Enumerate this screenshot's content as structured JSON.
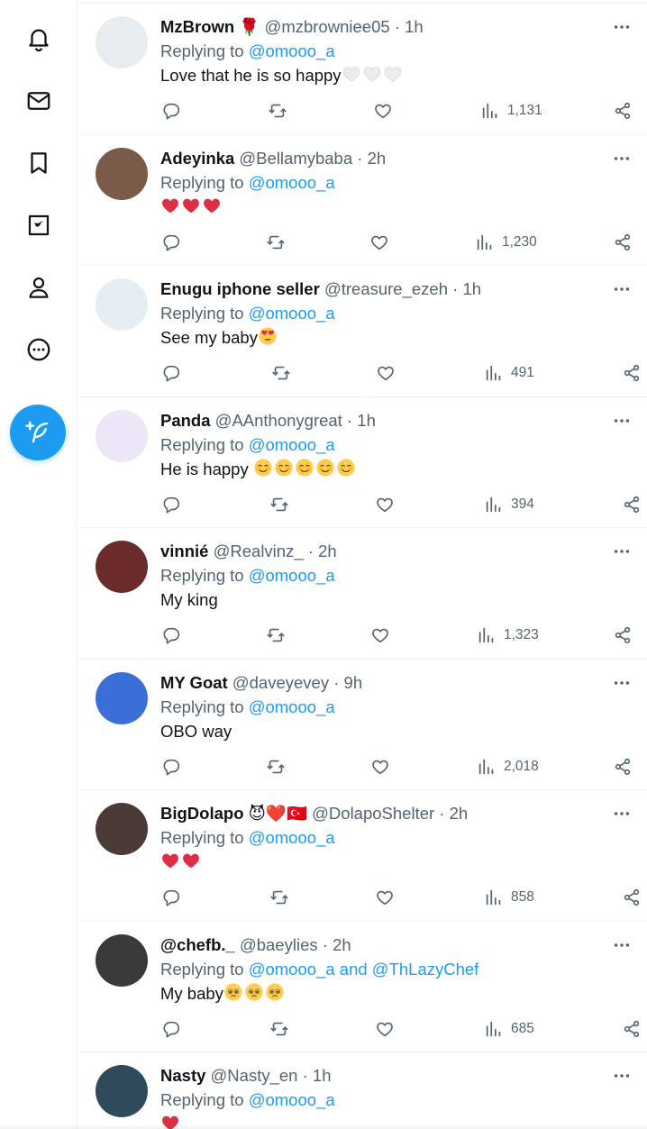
{
  "app": {
    "sidebar": {
      "items": [
        {
          "icon": "bell-icon",
          "label": "Notifications"
        },
        {
          "icon": "envelope-icon",
          "label": "Messages"
        },
        {
          "icon": "bookmark-icon",
          "label": "Bookmarks"
        },
        {
          "icon": "twitter-blue-icon",
          "label": "Twitter Blue"
        },
        {
          "icon": "person-icon",
          "label": "Profile"
        },
        {
          "icon": "more-circle-icon",
          "label": "More"
        }
      ],
      "compose_icon": "feather-plus-icon"
    },
    "colors": {
      "accent": "#1d9bf0",
      "secondary_text": "#536471",
      "heart": "#f91880"
    }
  },
  "replying_label": "Replying to",
  "tweets": [
    {
      "name": "MzBrown",
      "name_suffix": "🌹",
      "handle": "@mzbrowniee05",
      "time": "1h",
      "mention": "@omooo_a",
      "mention_extra": "",
      "text": "Love that he is so happy",
      "emojis": [
        "white-heart",
        "white-heart",
        "white-heart"
      ],
      "views": "1,131",
      "avatar_color": "#e9ecef"
    },
    {
      "name": "Adeyinka",
      "name_suffix": "",
      "handle": "@Bellamybaba",
      "time": "2h",
      "mention": "@omooo_a",
      "mention_extra": "",
      "text": "",
      "emojis": [
        "red-heart",
        "red-heart",
        "red-heart"
      ],
      "views": "1,230",
      "avatar_color": "#7a5a48"
    },
    {
      "name": "Enugu iphone seller",
      "name_suffix": "",
      "handle": "@treasure_ezeh",
      "time": "1h",
      "mention": "@omooo_a",
      "mention_extra": "",
      "text": "See my baby",
      "emojis": [
        "heart-eyes"
      ],
      "views": "491",
      "avatar_color": "#e7eef3"
    },
    {
      "name": "Panda",
      "name_suffix": "",
      "handle": "@AAnthonygreat",
      "time": "1h",
      "mention": "@omooo_a",
      "mention_extra": "",
      "text": "He is happy ",
      "emojis": [
        "smiling-blush",
        "smiling-blush",
        "smiling-blush",
        "smiling-blush",
        "smiling-blush"
      ],
      "views": "394",
      "avatar_color": "#ede6f6"
    },
    {
      "name": "vinnié",
      "name_suffix": "",
      "handle": "@Realvinz_",
      "time": "2h",
      "mention": "@omooo_a",
      "mention_extra": "",
      "text": "My king",
      "emojis": [],
      "views": "1,323",
      "avatar_color": "#6b2b2b"
    },
    {
      "name": "MY Goat",
      "name_suffix": "",
      "handle": "@daveyevey",
      "time": "9h",
      "mention": "@omooo_a",
      "mention_extra": "",
      "text": "OBO way",
      "emojis": [],
      "views": "2,018",
      "avatar_color": "#3b6fd8"
    },
    {
      "name": "BigDolapo",
      "name_suffix": "😈❤️🇹🇷",
      "handle": "@DolapoShelter",
      "time": "2h",
      "mention": "@omooo_a",
      "mention_extra": "",
      "text": "",
      "emojis": [
        "red-heart",
        "red-heart"
      ],
      "views": "858",
      "avatar_color": "#4a3b36"
    },
    {
      "name": "@chefb._",
      "name_suffix": "",
      "handle": "@baeylies",
      "time": "2h",
      "mention": "@omooo_a",
      "mention_extra": "and @ThLazyChef",
      "text": "My baby",
      "emojis": [
        "pleading-face",
        "pleading-face",
        "pleading-face"
      ],
      "views": "685",
      "avatar_color": "#3a3a3a"
    },
    {
      "name": "Nasty",
      "name_suffix": "",
      "handle": "@Nasty_en",
      "time": "1h",
      "mention": "@omooo_a",
      "mention_extra": "",
      "text": "",
      "emojis": [
        "red-heart"
      ],
      "views": "",
      "avatar_color": "#2f4a5a"
    }
  ]
}
